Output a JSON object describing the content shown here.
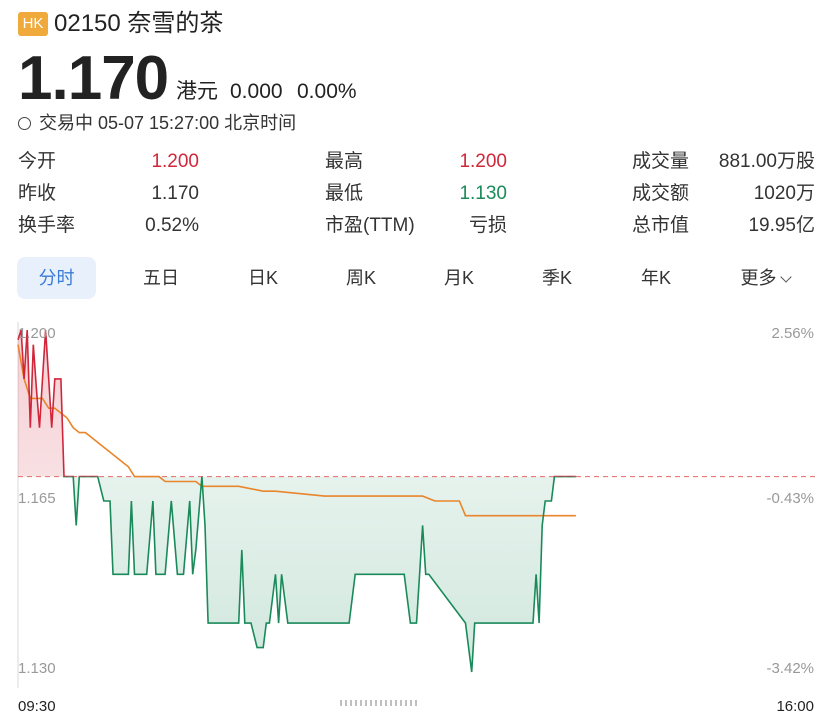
{
  "header": {
    "market_badge": "HK",
    "title": "02150 奈雪的茶"
  },
  "quote": {
    "price": "1.170",
    "currency": "港元",
    "change": "0.000",
    "change_pct": "0.00%"
  },
  "status": {
    "text": "交易中 05-07 15:27:00 北京时间"
  },
  "stats": [
    {
      "label": "今开",
      "value": "1.200",
      "color": "#d0263a"
    },
    {
      "label": "最高",
      "value": "1.200",
      "color": "#d0263a"
    },
    {
      "label": "成交量",
      "value": "881.00万股",
      "color": "#333333"
    },
    {
      "label": "昨收",
      "value": "1.170",
      "color": "#333333"
    },
    {
      "label": "最低",
      "value": "1.130",
      "color": "#1a8a5a"
    },
    {
      "label": "成交额",
      "value": "1020万",
      "color": "#333333"
    },
    {
      "label": "换手率",
      "value": "0.52%",
      "color": "#333333"
    },
    {
      "label": "市盈(TTM)",
      "value": "亏损",
      "color": "#333333"
    },
    {
      "label": "总市值",
      "value": "19.95亿",
      "color": "#333333"
    }
  ],
  "tabs": [
    {
      "label": "分时",
      "active": true
    },
    {
      "label": "五日"
    },
    {
      "label": "日K"
    },
    {
      "label": "周K"
    },
    {
      "label": "月K"
    },
    {
      "label": "季K"
    },
    {
      "label": "年K"
    },
    {
      "label": "更多"
    }
  ],
  "colors": {
    "up": "#d0263a",
    "down": "#1a8a5a",
    "accent": "#3a7bd5",
    "avg_line": "#e9852a",
    "badge": "#f0a93b"
  },
  "chart_data": {
    "type": "line",
    "x_start": "09:30",
    "x_end": "16:00",
    "ylim": [
      1.13,
      1.2
    ],
    "prev_close": 1.17,
    "y_labels": [
      "1.200",
      "1.165",
      "1.130"
    ],
    "y_pct_labels": [
      "2.56%",
      "-0.43%",
      "-3.42%"
    ],
    "series": [
      {
        "role": "price",
        "points": [
          [
            0,
            1.198
          ],
          [
            0.5,
            1.2
          ],
          [
            1,
            1.19
          ],
          [
            1.5,
            1.2
          ],
          [
            2,
            1.18
          ],
          [
            2.5,
            1.197
          ],
          [
            3,
            1.188
          ],
          [
            3.5,
            1.18
          ],
          [
            4,
            1.19
          ],
          [
            4.5,
            1.2
          ],
          [
            5,
            1.19
          ],
          [
            5.5,
            1.18
          ],
          [
            6,
            1.19
          ],
          [
            6.5,
            1.19
          ],
          [
            7,
            1.19
          ],
          [
            7.5,
            1.17
          ],
          [
            8,
            1.17
          ],
          [
            9,
            1.17
          ],
          [
            9.5,
            1.16
          ],
          [
            10,
            1.17
          ],
          [
            11,
            1.17
          ],
          [
            12,
            1.17
          ],
          [
            13,
            1.17
          ],
          [
            14,
            1.165
          ],
          [
            15,
            1.165
          ],
          [
            15.5,
            1.15
          ],
          [
            17,
            1.15
          ],
          [
            18,
            1.15
          ],
          [
            18.5,
            1.165
          ],
          [
            19,
            1.15
          ],
          [
            21,
            1.15
          ],
          [
            22,
            1.165
          ],
          [
            22.5,
            1.15
          ],
          [
            24,
            1.15
          ],
          [
            25,
            1.165
          ],
          [
            26,
            1.15
          ],
          [
            27,
            1.15
          ],
          [
            28,
            1.165
          ],
          [
            28.5,
            1.15
          ],
          [
            29,
            1.155
          ],
          [
            30,
            1.17
          ],
          [
            30.5,
            1.16
          ],
          [
            31,
            1.14
          ],
          [
            36,
            1.14
          ],
          [
            36.5,
            1.155
          ],
          [
            37,
            1.14
          ],
          [
            38,
            1.14
          ],
          [
            39,
            1.135
          ],
          [
            40,
            1.135
          ],
          [
            40.5,
            1.14
          ],
          [
            41,
            1.14
          ],
          [
            42,
            1.15
          ],
          [
            42.5,
            1.14
          ],
          [
            43,
            1.15
          ],
          [
            44,
            1.14
          ],
          [
            54,
            1.14
          ],
          [
            55,
            1.15
          ],
          [
            58,
            1.15
          ],
          [
            63,
            1.15
          ],
          [
            64,
            1.14
          ],
          [
            65,
            1.14
          ],
          [
            65.5,
            1.15
          ],
          [
            66,
            1.16
          ],
          [
            66.5,
            1.15
          ],
          [
            67,
            1.15
          ],
          [
            73,
            1.14
          ],
          [
            74,
            1.13
          ],
          [
            74.5,
            1.14
          ],
          [
            76,
            1.14
          ],
          [
            84,
            1.14
          ],
          [
            84.5,
            1.15
          ],
          [
            85,
            1.14
          ],
          [
            85.5,
            1.16
          ],
          [
            86,
            1.165
          ],
          [
            87,
            1.165
          ],
          [
            87.5,
            1.17
          ],
          [
            91,
            1.17
          ]
        ]
      },
      {
        "role": "average",
        "points": [
          [
            0,
            1.197
          ],
          [
            1,
            1.19
          ],
          [
            2,
            1.186
          ],
          [
            3,
            1.186
          ],
          [
            4,
            1.186
          ],
          [
            5,
            1.184
          ],
          [
            6,
            1.184
          ],
          [
            8,
            1.182
          ],
          [
            9,
            1.18
          ],
          [
            10,
            1.179
          ],
          [
            11,
            1.179
          ],
          [
            12,
            1.178
          ],
          [
            13,
            1.177
          ],
          [
            14,
            1.176
          ],
          [
            15,
            1.175
          ],
          [
            16,
            1.174
          ],
          [
            17,
            1.173
          ],
          [
            18,
            1.172
          ],
          [
            19,
            1.17
          ],
          [
            20,
            1.17
          ],
          [
            23,
            1.17
          ],
          [
            24,
            1.169
          ],
          [
            29,
            1.169
          ],
          [
            30,
            1.168
          ],
          [
            36,
            1.168
          ],
          [
            40,
            1.167
          ],
          [
            42,
            1.167
          ],
          [
            50,
            1.166
          ],
          [
            56,
            1.166
          ],
          [
            66,
            1.166
          ],
          [
            68,
            1.165
          ],
          [
            72,
            1.165
          ],
          [
            73,
            1.162
          ],
          [
            80,
            1.162
          ],
          [
            91,
            1.162
          ]
        ]
      }
    ]
  }
}
